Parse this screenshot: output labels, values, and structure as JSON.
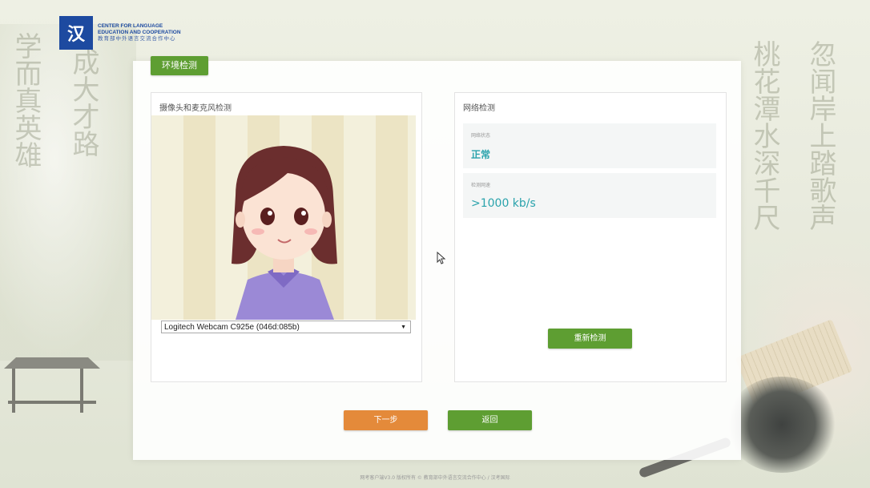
{
  "logo": {
    "mark": "汉",
    "line1": "CENTER FOR LANGUAGE",
    "line2": "EDUCATION AND COOPERATION",
    "line3": "教育部中外语言交流合作中心"
  },
  "tab": {
    "label": "环境检测"
  },
  "camera": {
    "title": "摄像头和麦克风检测",
    "device": "Logitech Webcam C925e (046d:085b)"
  },
  "network": {
    "title": "网络检测",
    "status_label": "网络状态",
    "status_value": "正常",
    "speed_label": "检测网速",
    "speed_value": ">1000 kb/s",
    "retest": "重新检测"
  },
  "actions": {
    "next": "下一步",
    "back": "返回"
  },
  "footer": "网考客户端V3.0 版权所有 © 教育部中外语言交流合作中心 / 汉考国际"
}
